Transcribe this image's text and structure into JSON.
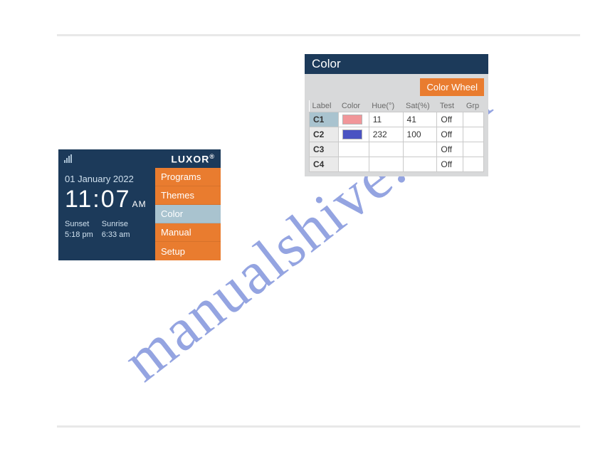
{
  "watermark": "manualshive.com",
  "luxor": {
    "brand": "LUXOR",
    "brand_sup": "®",
    "date": "01 January 2022",
    "time": "11:07",
    "ampm": "AM",
    "sunset_lbl": "Sunset",
    "sunset_val": "5:18 pm",
    "sunrise_lbl": "Sunrise",
    "sunrise_val": "6:33 am",
    "menu": {
      "programs": "Programs",
      "themes": "Themes",
      "color": "Color",
      "manual": "Manual",
      "setup": "Setup"
    }
  },
  "colorbox": {
    "title": "Color",
    "wheel_btn": "Color Wheel",
    "headers": {
      "label": "Label",
      "color": "Color",
      "hue": "Hue(°)",
      "sat": "Sat(%)",
      "test": "Test",
      "grp": "Grp"
    },
    "rows": [
      {
        "label": "C1",
        "swatch": "#f19699",
        "hue": "11",
        "sat": "41",
        "test": "Off",
        "grp": "",
        "selected": true
      },
      {
        "label": "C2",
        "swatch": "#4a53c2",
        "hue": "232",
        "sat": "100",
        "test": "Off",
        "grp": "",
        "selected": false
      },
      {
        "label": "C3",
        "swatch": "",
        "hue": "",
        "sat": "",
        "test": "Off",
        "grp": "",
        "selected": false
      },
      {
        "label": "C4",
        "swatch": "",
        "hue": "",
        "sat": "",
        "test": "Off",
        "grp": "",
        "selected": false
      }
    ]
  }
}
